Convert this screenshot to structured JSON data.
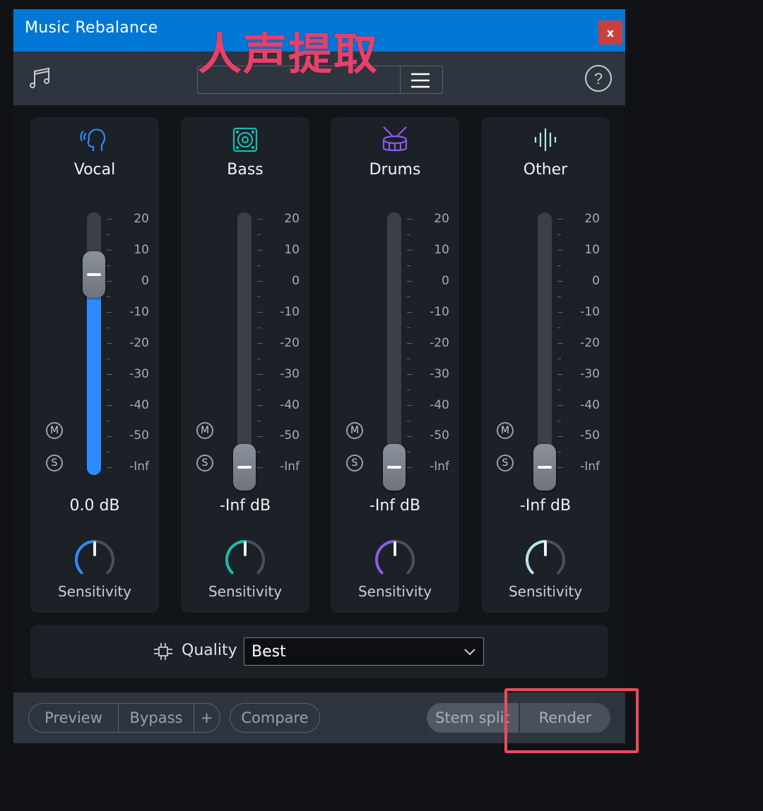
{
  "window": {
    "title": "Music Rebalance",
    "close_label": "x"
  },
  "overlay": {
    "annotation_text": "人声提取"
  },
  "toolbar": {
    "preset_value": "",
    "note_icon": "music-notes-icon",
    "menu_icon": "hamburger-icon",
    "help_label": "?"
  },
  "scale_labels": [
    "20",
    "10",
    "0",
    "-10",
    "-20",
    "-30",
    "-40",
    "-50",
    "-Inf"
  ],
  "channels": [
    {
      "name": "Vocal",
      "icon": "vocal-head-icon",
      "accent": "#2e8bff",
      "db": "0.0 dB",
      "gain_db": 0,
      "mute": "M",
      "solo": "S",
      "sensitivity_label": "Sensitivity",
      "knob_color": "#2e8bff"
    },
    {
      "name": "Bass",
      "icon": "speaker-icon",
      "accent": "#1fb8b0",
      "db": "-Inf dB",
      "gain_db": "-Inf",
      "mute": "M",
      "solo": "S",
      "sensitivity_label": "Sensitivity",
      "knob_color": "#1fb8b0"
    },
    {
      "name": "Drums",
      "icon": "drum-icon",
      "accent": "#8a5ce6",
      "db": "-Inf dB",
      "gain_db": "-Inf",
      "mute": "M",
      "solo": "S",
      "sensitivity_label": "Sensitivity",
      "knob_color": "#8a5ce6"
    },
    {
      "name": "Other",
      "icon": "waveform-icon",
      "accent": "#b6e4ec",
      "db": "-Inf dB",
      "gain_db": "-Inf",
      "mute": "M",
      "solo": "S",
      "sensitivity_label": "Sensitivity",
      "knob_color": "#b6e4ec"
    }
  ],
  "quality": {
    "label": "Quality",
    "value": "Best",
    "icon": "chip-icon"
  },
  "footer": {
    "preview": "Preview",
    "bypass": "Bypass",
    "add": "+",
    "compare": "Compare",
    "stem_split": "Stem split",
    "render": "Render"
  },
  "colors": {
    "titlebar": "#0077d5",
    "close": "#c8413f",
    "highlight": "#ea4b5c",
    "annotation": "#e8406a"
  }
}
